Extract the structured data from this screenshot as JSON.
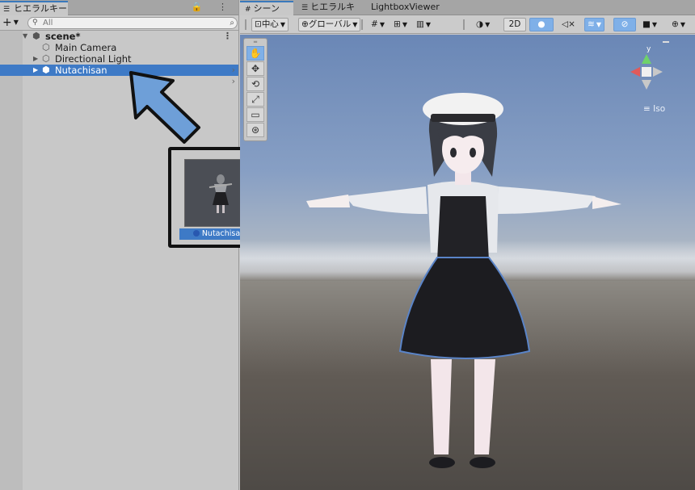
{
  "hierarchy": {
    "tab_label": "ヒエラルキー",
    "tab_tools": "🔒 ⋮",
    "add_label": "+",
    "search_placeholder": "All",
    "rows": [
      {
        "label": "scene*"
      },
      {
        "label": "Main Camera"
      },
      {
        "label": "Directional Light"
      },
      {
        "label": "Nutachisan"
      }
    ]
  },
  "drag_preview": {
    "label": "Nutachisan"
  },
  "scene_view": {
    "tabs": [
      {
        "label": "シーン"
      },
      {
        "label": "ヒエラルキー"
      },
      {
        "label": "LightboxViewer"
      }
    ],
    "toolbar": {
      "pivot_label": "中心",
      "space_label": "グローバル",
      "mode_2d_label": "2D"
    },
    "gizmo": {
      "projection_label": "Iso"
    }
  },
  "icons": {
    "hierarchy_tab": "list-icon",
    "scene_tab": "grid-icon",
    "unity_scene": "unity-logo-icon",
    "gameobject": "cube-icon"
  },
  "colors": {
    "selection": "#3e7ac6",
    "annotation_arrow": "#6e9fd8",
    "panel": "#c8c8c8"
  }
}
